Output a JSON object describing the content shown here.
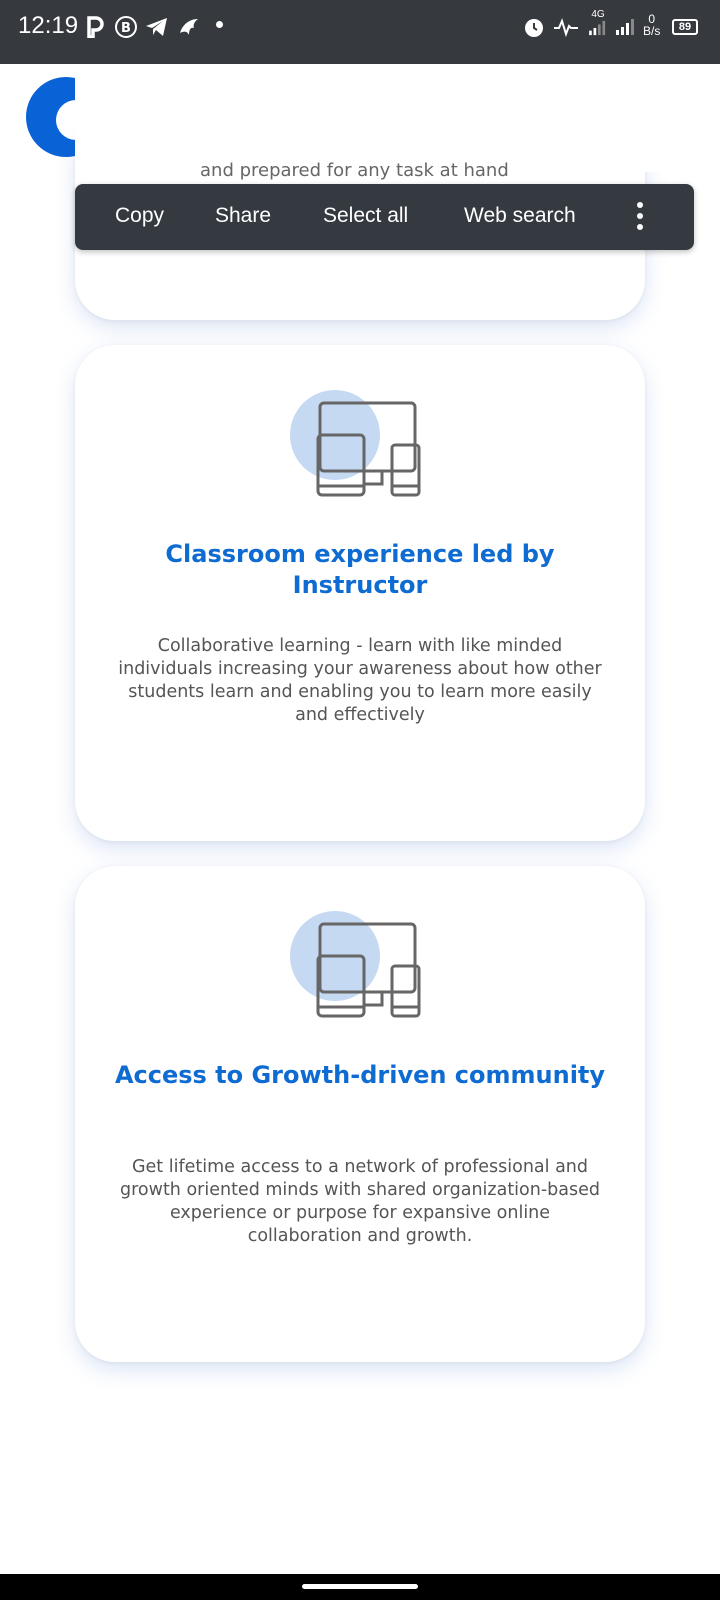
{
  "status_bar": {
    "time": "12:19",
    "network": "4G",
    "speed_value": "0",
    "speed_unit": "B/s",
    "battery": "89"
  },
  "header": {
    "logo_icon": "brand-c-logo",
    "menu_icon": "hamburger-menu-icon"
  },
  "partial_text": "and prepared for any task at hand",
  "selection_toolbar": {
    "items": [
      "Copy",
      "Share",
      "Select all",
      "Web search"
    ],
    "more_icon": "more-vert-icon"
  },
  "cards": [
    {
      "icon": "devices-icon",
      "title": "Classroom experience led by Instructor",
      "description": "Collaborative learning - learn with like minded individuals increasing your awareness about how other students learn and enabling you to learn more easily and effectively"
    },
    {
      "icon": "devices-icon",
      "title": "Access to Growth-driven community",
      "description": "Get lifetime access to a network of professional and growth oriented minds with shared organization-based experience or purpose for expansive online collaboration and growth."
    }
  ],
  "colors": {
    "accent": "#0d6bd2",
    "status_bar": "#36393e",
    "toolbar": "#353a41",
    "icon_circle": "#c5d9f3",
    "icon_stroke": "#666666"
  }
}
